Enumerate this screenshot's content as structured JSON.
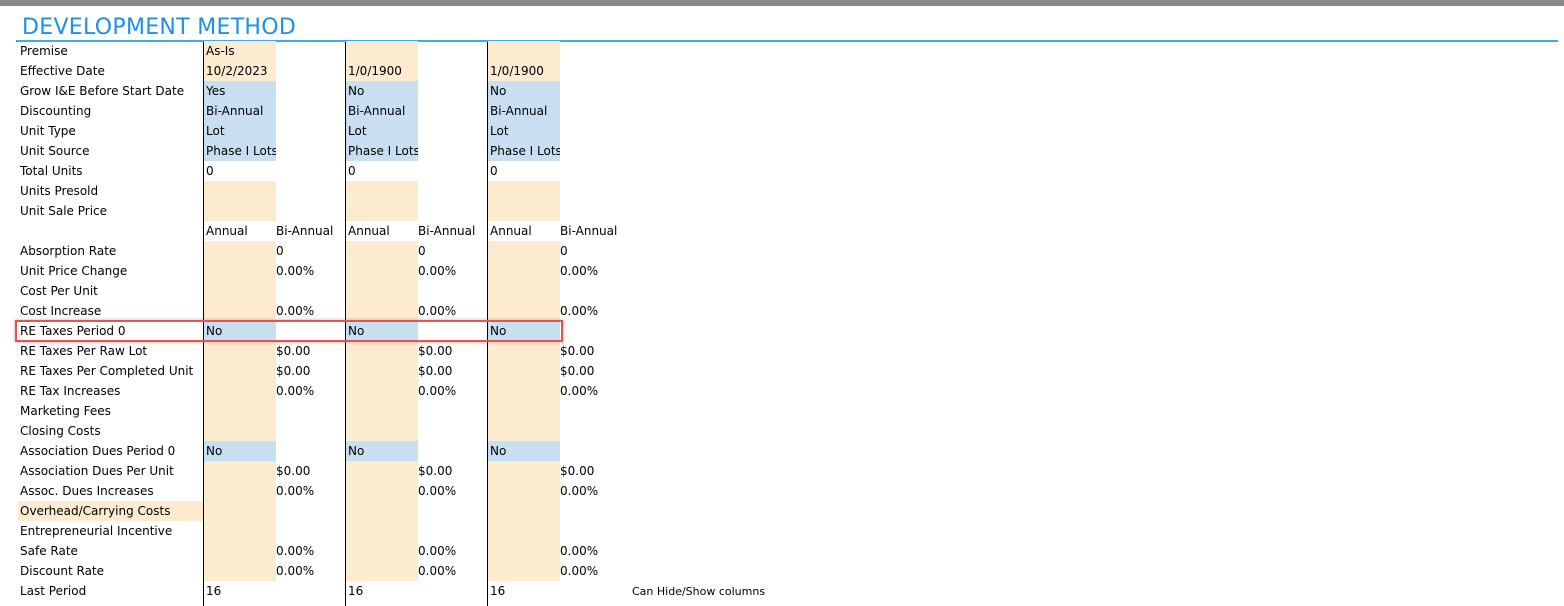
{
  "sheet": {
    "title": "DEVELOPMENT METHOD",
    "note": "Can Hide/Show columns"
  },
  "rows": [
    {
      "label": "Premise",
      "label_fill": "",
      "cells": [
        {
          "t": "As-Is",
          "f": "tan"
        },
        {
          "t": "",
          "f": ""
        },
        {
          "t": "",
          "f": "tan"
        },
        {
          "t": "",
          "f": ""
        },
        {
          "t": "",
          "f": "tan"
        },
        {
          "t": "",
          "f": ""
        }
      ]
    },
    {
      "label": "Effective Date",
      "label_fill": "",
      "cells": [
        {
          "t": "10/2/2023",
          "f": "tan"
        },
        {
          "t": "",
          "f": ""
        },
        {
          "t": "1/0/1900",
          "f": "tan"
        },
        {
          "t": "",
          "f": ""
        },
        {
          "t": "1/0/1900",
          "f": "tan"
        },
        {
          "t": "",
          "f": ""
        }
      ]
    },
    {
      "label": "Grow I&E Before Start Date",
      "label_fill": "",
      "cells": [
        {
          "t": "Yes",
          "f": "blu"
        },
        {
          "t": "",
          "f": ""
        },
        {
          "t": "No",
          "f": "blu"
        },
        {
          "t": "",
          "f": ""
        },
        {
          "t": "No",
          "f": "blu"
        },
        {
          "t": "",
          "f": ""
        }
      ]
    },
    {
      "label": "Discounting",
      "label_fill": "",
      "cells": [
        {
          "t": "Bi-Annual",
          "f": "blu"
        },
        {
          "t": "",
          "f": ""
        },
        {
          "t": "Bi-Annual",
          "f": "blu"
        },
        {
          "t": "",
          "f": ""
        },
        {
          "t": "Bi-Annual",
          "f": "blu"
        },
        {
          "t": "",
          "f": ""
        }
      ]
    },
    {
      "label": "Unit Type",
      "label_fill": "",
      "cells": [
        {
          "t": "Lot",
          "f": "blu"
        },
        {
          "t": "",
          "f": ""
        },
        {
          "t": "Lot",
          "f": "blu"
        },
        {
          "t": "",
          "f": ""
        },
        {
          "t": "Lot",
          "f": "blu"
        },
        {
          "t": "",
          "f": ""
        }
      ]
    },
    {
      "label": "Unit Source",
      "label_fill": "",
      "cells": [
        {
          "t": "Phase I Lots",
          "f": "blu"
        },
        {
          "t": "",
          "f": ""
        },
        {
          "t": "Phase I Lots",
          "f": "blu"
        },
        {
          "t": "",
          "f": ""
        },
        {
          "t": "Phase I Lots",
          "f": "blu"
        },
        {
          "t": "",
          "f": ""
        }
      ]
    },
    {
      "label": "Total Units",
      "label_fill": "",
      "cells": [
        {
          "t": "0",
          "f": ""
        },
        {
          "t": "",
          "f": ""
        },
        {
          "t": "0",
          "f": ""
        },
        {
          "t": "",
          "f": ""
        },
        {
          "t": "0",
          "f": ""
        },
        {
          "t": "",
          "f": ""
        }
      ]
    },
    {
      "label": "Units Presold",
      "label_fill": "",
      "cells": [
        {
          "t": "",
          "f": "tan"
        },
        {
          "t": "",
          "f": ""
        },
        {
          "t": "",
          "f": "tan"
        },
        {
          "t": "",
          "f": ""
        },
        {
          "t": "",
          "f": "tan"
        },
        {
          "t": "",
          "f": ""
        }
      ]
    },
    {
      "label": "Unit Sale Price",
      "label_fill": "",
      "cells": [
        {
          "t": "",
          "f": "tan"
        },
        {
          "t": "",
          "f": ""
        },
        {
          "t": "",
          "f": "tan"
        },
        {
          "t": "",
          "f": ""
        },
        {
          "t": "",
          "f": "tan"
        },
        {
          "t": "",
          "f": ""
        }
      ]
    },
    {
      "label": "",
      "label_fill": "",
      "cells": [
        {
          "t": "Annual",
          "f": ""
        },
        {
          "t": "Bi-Annual",
          "f": ""
        },
        {
          "t": "Annual",
          "f": ""
        },
        {
          "t": "Bi-Annual",
          "f": ""
        },
        {
          "t": "Annual",
          "f": ""
        },
        {
          "t": "Bi-Annual",
          "f": ""
        }
      ]
    },
    {
      "label": "Absorption Rate",
      "label_fill": "",
      "cells": [
        {
          "t": "",
          "f": "tan"
        },
        {
          "t": "0",
          "f": ""
        },
        {
          "t": "",
          "f": "tan"
        },
        {
          "t": "0",
          "f": ""
        },
        {
          "t": "",
          "f": "tan"
        },
        {
          "t": "0",
          "f": ""
        }
      ]
    },
    {
      "label": "Unit Price Change",
      "label_fill": "",
      "cells": [
        {
          "t": "",
          "f": "tan"
        },
        {
          "t": "0.00%",
          "f": ""
        },
        {
          "t": "",
          "f": "tan"
        },
        {
          "t": "0.00%",
          "f": ""
        },
        {
          "t": "",
          "f": "tan"
        },
        {
          "t": "0.00%",
          "f": ""
        }
      ]
    },
    {
      "label": "Cost Per Unit",
      "label_fill": "",
      "cells": [
        {
          "t": "",
          "f": "tan"
        },
        {
          "t": "",
          "f": ""
        },
        {
          "t": "",
          "f": "tan"
        },
        {
          "t": "",
          "f": ""
        },
        {
          "t": "",
          "f": "tan"
        },
        {
          "t": "",
          "f": ""
        }
      ]
    },
    {
      "label": "Cost Increase",
      "label_fill": "",
      "cells": [
        {
          "t": "",
          "f": "tan"
        },
        {
          "t": "0.00%",
          "f": ""
        },
        {
          "t": "",
          "f": "tan"
        },
        {
          "t": "0.00%",
          "f": ""
        },
        {
          "t": "",
          "f": "tan"
        },
        {
          "t": "0.00%",
          "f": ""
        }
      ]
    },
    {
      "label": "RE Taxes Period 0",
      "label_fill": "",
      "cells": [
        {
          "t": "No",
          "f": "blu"
        },
        {
          "t": "",
          "f": ""
        },
        {
          "t": "No",
          "f": "blu"
        },
        {
          "t": "",
          "f": ""
        },
        {
          "t": "No",
          "f": "blu"
        },
        {
          "t": "",
          "f": ""
        }
      ]
    },
    {
      "label": "RE Taxes Per Raw Lot",
      "label_fill": "",
      "cells": [
        {
          "t": "",
          "f": "tan"
        },
        {
          "t": "$0.00",
          "f": ""
        },
        {
          "t": "",
          "f": "tan"
        },
        {
          "t": "$0.00",
          "f": ""
        },
        {
          "t": "",
          "f": "tan"
        },
        {
          "t": "$0.00",
          "f": ""
        }
      ]
    },
    {
      "label": "RE Taxes Per Completed Unit",
      "label_fill": "",
      "cells": [
        {
          "t": "",
          "f": "tan"
        },
        {
          "t": "$0.00",
          "f": ""
        },
        {
          "t": "",
          "f": "tan"
        },
        {
          "t": "$0.00",
          "f": ""
        },
        {
          "t": "",
          "f": "tan"
        },
        {
          "t": "$0.00",
          "f": ""
        }
      ]
    },
    {
      "label": "RE Tax Increases",
      "label_fill": "",
      "cells": [
        {
          "t": "",
          "f": "tan"
        },
        {
          "t": "0.00%",
          "f": ""
        },
        {
          "t": "",
          "f": "tan"
        },
        {
          "t": "0.00%",
          "f": ""
        },
        {
          "t": "",
          "f": "tan"
        },
        {
          "t": "0.00%",
          "f": ""
        }
      ]
    },
    {
      "label": "Marketing Fees",
      "label_fill": "",
      "cells": [
        {
          "t": "",
          "f": "tan"
        },
        {
          "t": "",
          "f": ""
        },
        {
          "t": "",
          "f": "tan"
        },
        {
          "t": "",
          "f": ""
        },
        {
          "t": "",
          "f": "tan"
        },
        {
          "t": "",
          "f": ""
        }
      ]
    },
    {
      "label": "Closing Costs",
      "label_fill": "",
      "cells": [
        {
          "t": "",
          "f": "tan"
        },
        {
          "t": "",
          "f": ""
        },
        {
          "t": "",
          "f": "tan"
        },
        {
          "t": "",
          "f": ""
        },
        {
          "t": "",
          "f": "tan"
        },
        {
          "t": "",
          "f": ""
        }
      ]
    },
    {
      "label": "Association Dues Period 0",
      "label_fill": "",
      "cells": [
        {
          "t": "No",
          "f": "blu"
        },
        {
          "t": "",
          "f": ""
        },
        {
          "t": "No",
          "f": "blu"
        },
        {
          "t": "",
          "f": ""
        },
        {
          "t": "No",
          "f": "blu"
        },
        {
          "t": "",
          "f": ""
        }
      ]
    },
    {
      "label": "Association Dues Per Unit",
      "label_fill": "",
      "cells": [
        {
          "t": "",
          "f": "tan"
        },
        {
          "t": "$0.00",
          "f": ""
        },
        {
          "t": "",
          "f": "tan"
        },
        {
          "t": "$0.00",
          "f": ""
        },
        {
          "t": "",
          "f": "tan"
        },
        {
          "t": "$0.00",
          "f": ""
        }
      ]
    },
    {
      "label": "Assoc. Dues Increases",
      "label_fill": "",
      "cells": [
        {
          "t": "",
          "f": "tan"
        },
        {
          "t": "0.00%",
          "f": ""
        },
        {
          "t": "",
          "f": "tan"
        },
        {
          "t": "0.00%",
          "f": ""
        },
        {
          "t": "",
          "f": "tan"
        },
        {
          "t": "0.00%",
          "f": ""
        }
      ]
    },
    {
      "label": "Overhead/Carrying Costs",
      "label_fill": "tan",
      "cells": [
        {
          "t": "",
          "f": "tan"
        },
        {
          "t": "",
          "f": ""
        },
        {
          "t": "",
          "f": "tan"
        },
        {
          "t": "",
          "f": ""
        },
        {
          "t": "",
          "f": "tan"
        },
        {
          "t": "",
          "f": ""
        }
      ]
    },
    {
      "label": "Entrepreneurial Incentive",
      "label_fill": "",
      "cells": [
        {
          "t": "",
          "f": "tan"
        },
        {
          "t": "",
          "f": ""
        },
        {
          "t": "",
          "f": "tan"
        },
        {
          "t": "",
          "f": ""
        },
        {
          "t": "",
          "f": "tan"
        },
        {
          "t": "",
          "f": ""
        }
      ]
    },
    {
      "label": "Safe Rate",
      "label_fill": "",
      "cells": [
        {
          "t": "",
          "f": "tan"
        },
        {
          "t": "0.00%",
          "f": ""
        },
        {
          "t": "",
          "f": "tan"
        },
        {
          "t": "0.00%",
          "f": ""
        },
        {
          "t": "",
          "f": "tan"
        },
        {
          "t": "0.00%",
          "f": ""
        }
      ]
    },
    {
      "label": "Discount Rate",
      "label_fill": "",
      "cells": [
        {
          "t": "",
          "f": "tan"
        },
        {
          "t": "0.00%",
          "f": ""
        },
        {
          "t": "",
          "f": "tan"
        },
        {
          "t": "0.00%",
          "f": ""
        },
        {
          "t": "",
          "f": "tan"
        },
        {
          "t": "0.00%",
          "f": ""
        }
      ]
    },
    {
      "label": "Last Period",
      "label_fill": "",
      "cells": [
        {
          "t": "16",
          "f": ""
        },
        {
          "t": "",
          "f": ""
        },
        {
          "t": "16",
          "f": ""
        },
        {
          "t": "",
          "f": ""
        },
        {
          "t": "16",
          "f": ""
        },
        {
          "t": "",
          "f": ""
        }
      ]
    }
  ],
  "colors": {
    "title": "#1e90e6",
    "input_tan": "#fdebd0",
    "dropdown_blue": "#c7dff0",
    "highlight_red": "#e25555"
  }
}
